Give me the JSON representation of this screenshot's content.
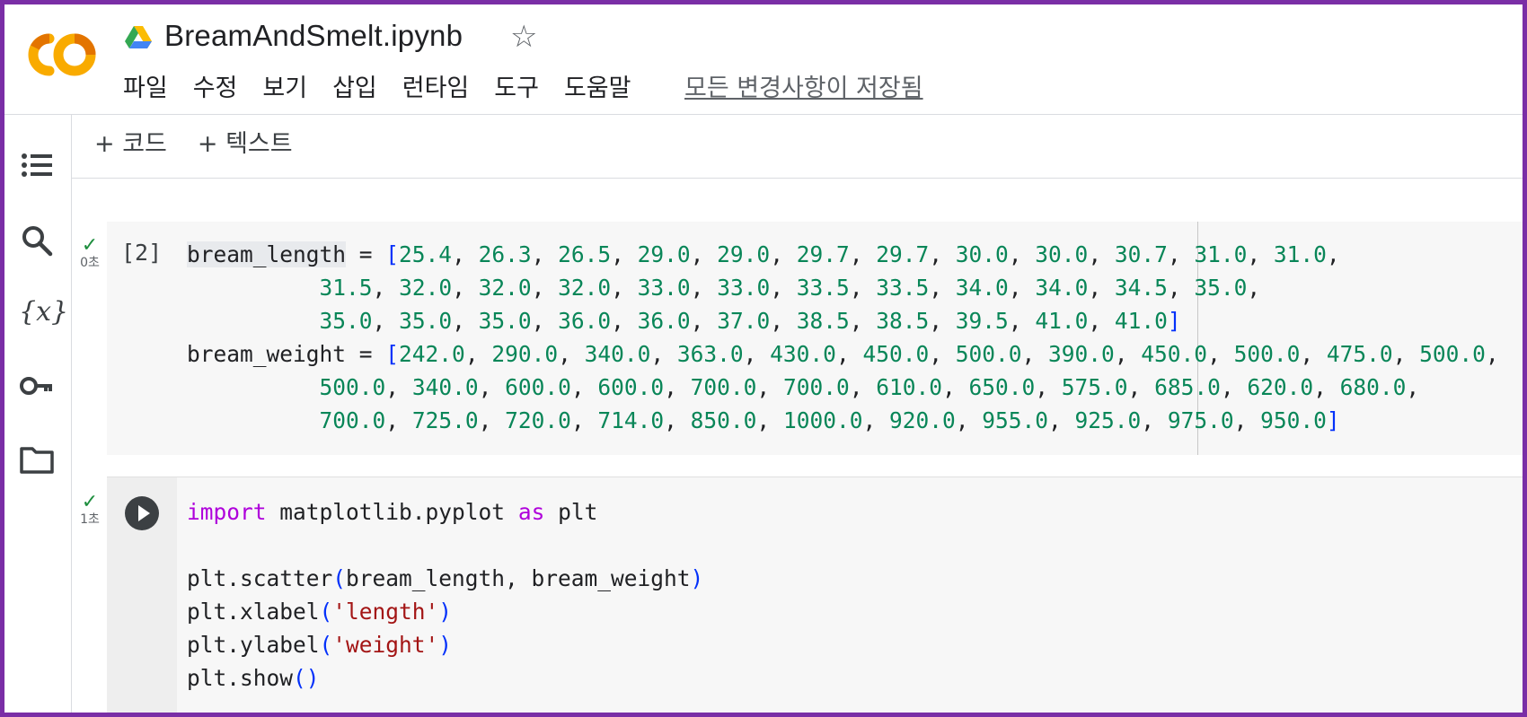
{
  "header": {
    "filename": "BreamAndSmelt.ipynb",
    "menu": [
      "파일",
      "수정",
      "보기",
      "삽입",
      "런타임",
      "도구",
      "도움말"
    ],
    "save_status": "모든 변경사항이 저장됨"
  },
  "toolbar": {
    "add_code": "+ 코드",
    "add_text": "+ 텍스트"
  },
  "cells": [
    {
      "exec_count": "[2]",
      "status_time": "0초",
      "var1": "bream_length",
      "var2": "bream_weight",
      "length_lines": [
        [
          "25.4",
          "26.3",
          "26.5",
          "29.0",
          "29.0",
          "29.7",
          "29.7",
          "30.0",
          "30.0",
          "30.7",
          "31.0",
          "31.0"
        ],
        [
          "31.5",
          "32.0",
          "32.0",
          "32.0",
          "33.0",
          "33.0",
          "33.5",
          "33.5",
          "34.0",
          "34.0",
          "34.5",
          "35.0"
        ],
        [
          "35.0",
          "35.0",
          "35.0",
          "36.0",
          "36.0",
          "37.0",
          "38.5",
          "38.5",
          "39.5",
          "41.0",
          "41.0"
        ]
      ],
      "weight_lines": [
        [
          "242.0",
          "290.0",
          "340.0",
          "363.0",
          "430.0",
          "450.0",
          "500.0",
          "390.0",
          "450.0",
          "500.0",
          "475.0",
          "500.0"
        ],
        [
          "500.0",
          "340.0",
          "600.0",
          "600.0",
          "700.0",
          "700.0",
          "610.0",
          "650.0",
          "575.0",
          "685.0",
          "620.0",
          "680.0"
        ],
        [
          "700.0",
          "725.0",
          "720.0",
          "714.0",
          "850.0",
          "1000.0",
          "920.0",
          "955.0",
          "925.0",
          "975.0",
          "950.0"
        ]
      ]
    },
    {
      "status_time": "1초",
      "import_kw": "import",
      "import_mod": "matplotlib.pyplot",
      "as_kw": "as",
      "alias": "plt",
      "scatter_call": "plt.scatter",
      "scatter_args": "bream_length, bream_weight",
      "xlabel_call": "plt.xlabel",
      "xlabel_arg": "'length'",
      "ylabel_call": "plt.ylabel",
      "ylabel_arg": "'weight'",
      "show_call": "plt.show"
    }
  ],
  "sidebar_icons": [
    "toc-icon",
    "search-icon",
    "variables-icon",
    "key-icon",
    "folder-icon"
  ]
}
